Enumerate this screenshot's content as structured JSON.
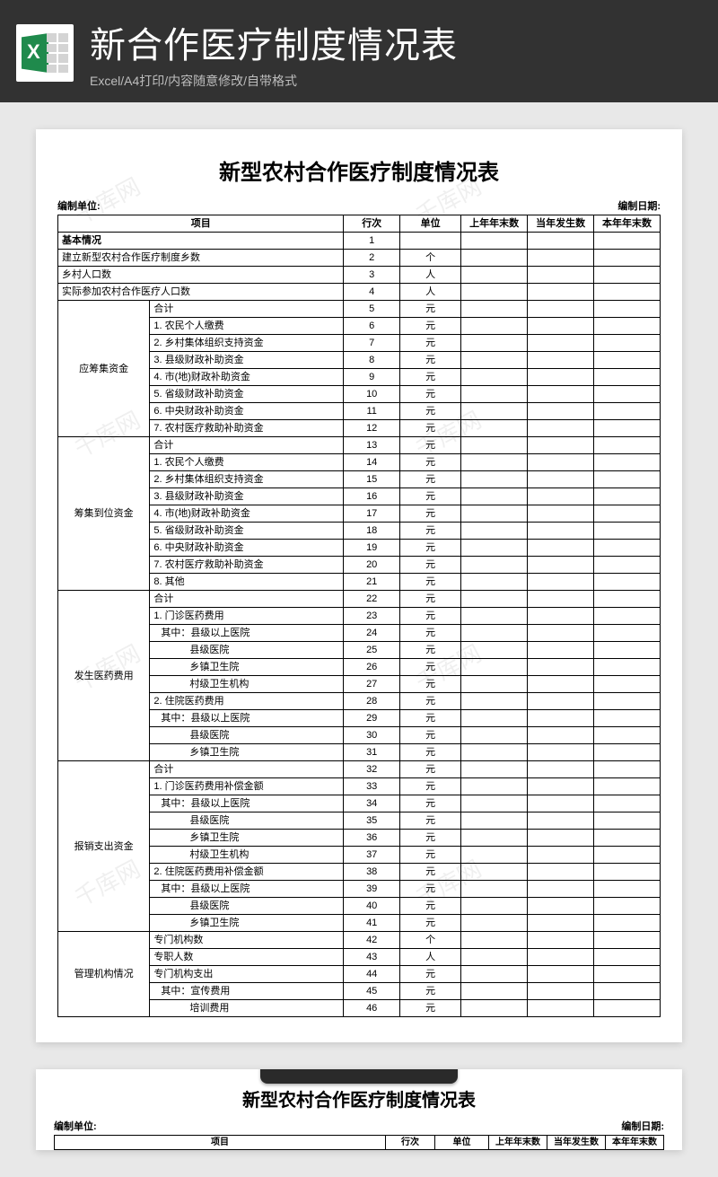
{
  "header": {
    "title": "新合作医疗制度情况表",
    "subtitle": "Excel/A4打印/内容随意修改/自带格式"
  },
  "doc": {
    "title": "新型农村合作医疗制度情况表",
    "org_label": "编制单位:",
    "date_label": "编制日期:"
  },
  "columns": {
    "item": "项目",
    "row": "行次",
    "unit": "单位",
    "prev": "上年年末数",
    "curr": "当年发生数",
    "end": "本年年末数"
  },
  "watermark": "千库网",
  "rows": [
    {
      "row": 1,
      "label": "基本情况",
      "unit": "",
      "span": "full",
      "bold": true
    },
    {
      "row": 2,
      "label": "建立新型农村合作医疗制度乡数",
      "unit": "个",
      "span": "full"
    },
    {
      "row": 3,
      "label": "乡村人口数",
      "unit": "人",
      "span": "full"
    },
    {
      "row": 4,
      "label": "实际参加农村合作医疗人口数",
      "unit": "人",
      "span": "full"
    },
    {
      "row": 5,
      "group": "应筹集资金",
      "gspan": 8,
      "label": "合计",
      "unit": "元"
    },
    {
      "row": 6,
      "label": "1. 农民个人缴费",
      "unit": "元"
    },
    {
      "row": 7,
      "label": "2. 乡村集体组织支持资金",
      "unit": "元"
    },
    {
      "row": 8,
      "label": "3. 县级财政补助资金",
      "unit": "元"
    },
    {
      "row": 9,
      "label": "4. 市(地)财政补助资金",
      "unit": "元"
    },
    {
      "row": 10,
      "label": "5. 省级财政补助资金",
      "unit": "元"
    },
    {
      "row": 11,
      "label": "6. 中央财政补助资金",
      "unit": "元"
    },
    {
      "row": 12,
      "label": "7. 农村医疗救助补助资金",
      "unit": "元"
    },
    {
      "row": 13,
      "group": "筹集到位资金",
      "gspan": 9,
      "label": "合计",
      "unit": "元"
    },
    {
      "row": 14,
      "label": "1. 农民个人缴费",
      "unit": "元"
    },
    {
      "row": 15,
      "label": "2. 乡村集体组织支持资金",
      "unit": "元"
    },
    {
      "row": 16,
      "label": "3. 县级财政补助资金",
      "unit": "元"
    },
    {
      "row": 17,
      "label": "4. 市(地)财政补助资金",
      "unit": "元"
    },
    {
      "row": 18,
      "label": "5. 省级财政补助资金",
      "unit": "元"
    },
    {
      "row": 19,
      "label": "6. 中央财政补助资金",
      "unit": "元"
    },
    {
      "row": 20,
      "label": "7. 农村医疗救助补助资金",
      "unit": "元"
    },
    {
      "row": 21,
      "label": "8. 其他",
      "unit": "元"
    },
    {
      "row": 22,
      "group": "发生医药费用",
      "gspan": 10,
      "label": "合计",
      "unit": "元"
    },
    {
      "row": 23,
      "label": "1. 门诊医药费用",
      "unit": "元"
    },
    {
      "row": 24,
      "label": "其中：县级以上医院",
      "unit": "元",
      "indent": 1
    },
    {
      "row": 25,
      "label": "县级医院",
      "unit": "元",
      "indent": 2
    },
    {
      "row": 26,
      "label": "乡镇卫生院",
      "unit": "元",
      "indent": 2
    },
    {
      "row": 27,
      "label": "村级卫生机构",
      "unit": "元",
      "indent": 2
    },
    {
      "row": 28,
      "label": "2. 住院医药费用",
      "unit": "元"
    },
    {
      "row": 29,
      "label": "其中：县级以上医院",
      "unit": "元",
      "indent": 1
    },
    {
      "row": 30,
      "label": "县级医院",
      "unit": "元",
      "indent": 2
    },
    {
      "row": 31,
      "label": "乡镇卫生院",
      "unit": "元",
      "indent": 2
    },
    {
      "row": 32,
      "group": "报销支出资金",
      "gspan": 10,
      "label": "合计",
      "unit": "元"
    },
    {
      "row": 33,
      "label": "1. 门诊医药费用补偿金额",
      "unit": "元"
    },
    {
      "row": 34,
      "label": "其中：县级以上医院",
      "unit": "元",
      "indent": 1
    },
    {
      "row": 35,
      "label": "县级医院",
      "unit": "元",
      "indent": 2
    },
    {
      "row": 36,
      "label": "乡镇卫生院",
      "unit": "元",
      "indent": 2
    },
    {
      "row": 37,
      "label": "村级卫生机构",
      "unit": "元",
      "indent": 2
    },
    {
      "row": 38,
      "label": "2. 住院医药费用补偿金额",
      "unit": "元"
    },
    {
      "row": 39,
      "label": "其中：县级以上医院",
      "unit": "元",
      "indent": 1
    },
    {
      "row": 40,
      "label": "县级医院",
      "unit": "元",
      "indent": 2
    },
    {
      "row": 41,
      "label": "乡镇卫生院",
      "unit": "元",
      "indent": 2
    },
    {
      "row": 42,
      "group": "管理机构情况",
      "gspan": 5,
      "label": "专门机构数",
      "unit": "个"
    },
    {
      "row": 43,
      "label": "专职人数",
      "unit": "人"
    },
    {
      "row": 44,
      "label": "专门机构支出",
      "unit": "元"
    },
    {
      "row": 45,
      "label": "其中：宣传费用",
      "unit": "元",
      "indent": 1
    },
    {
      "row": 46,
      "label": "培训费用",
      "unit": "元",
      "indent": 2
    }
  ]
}
